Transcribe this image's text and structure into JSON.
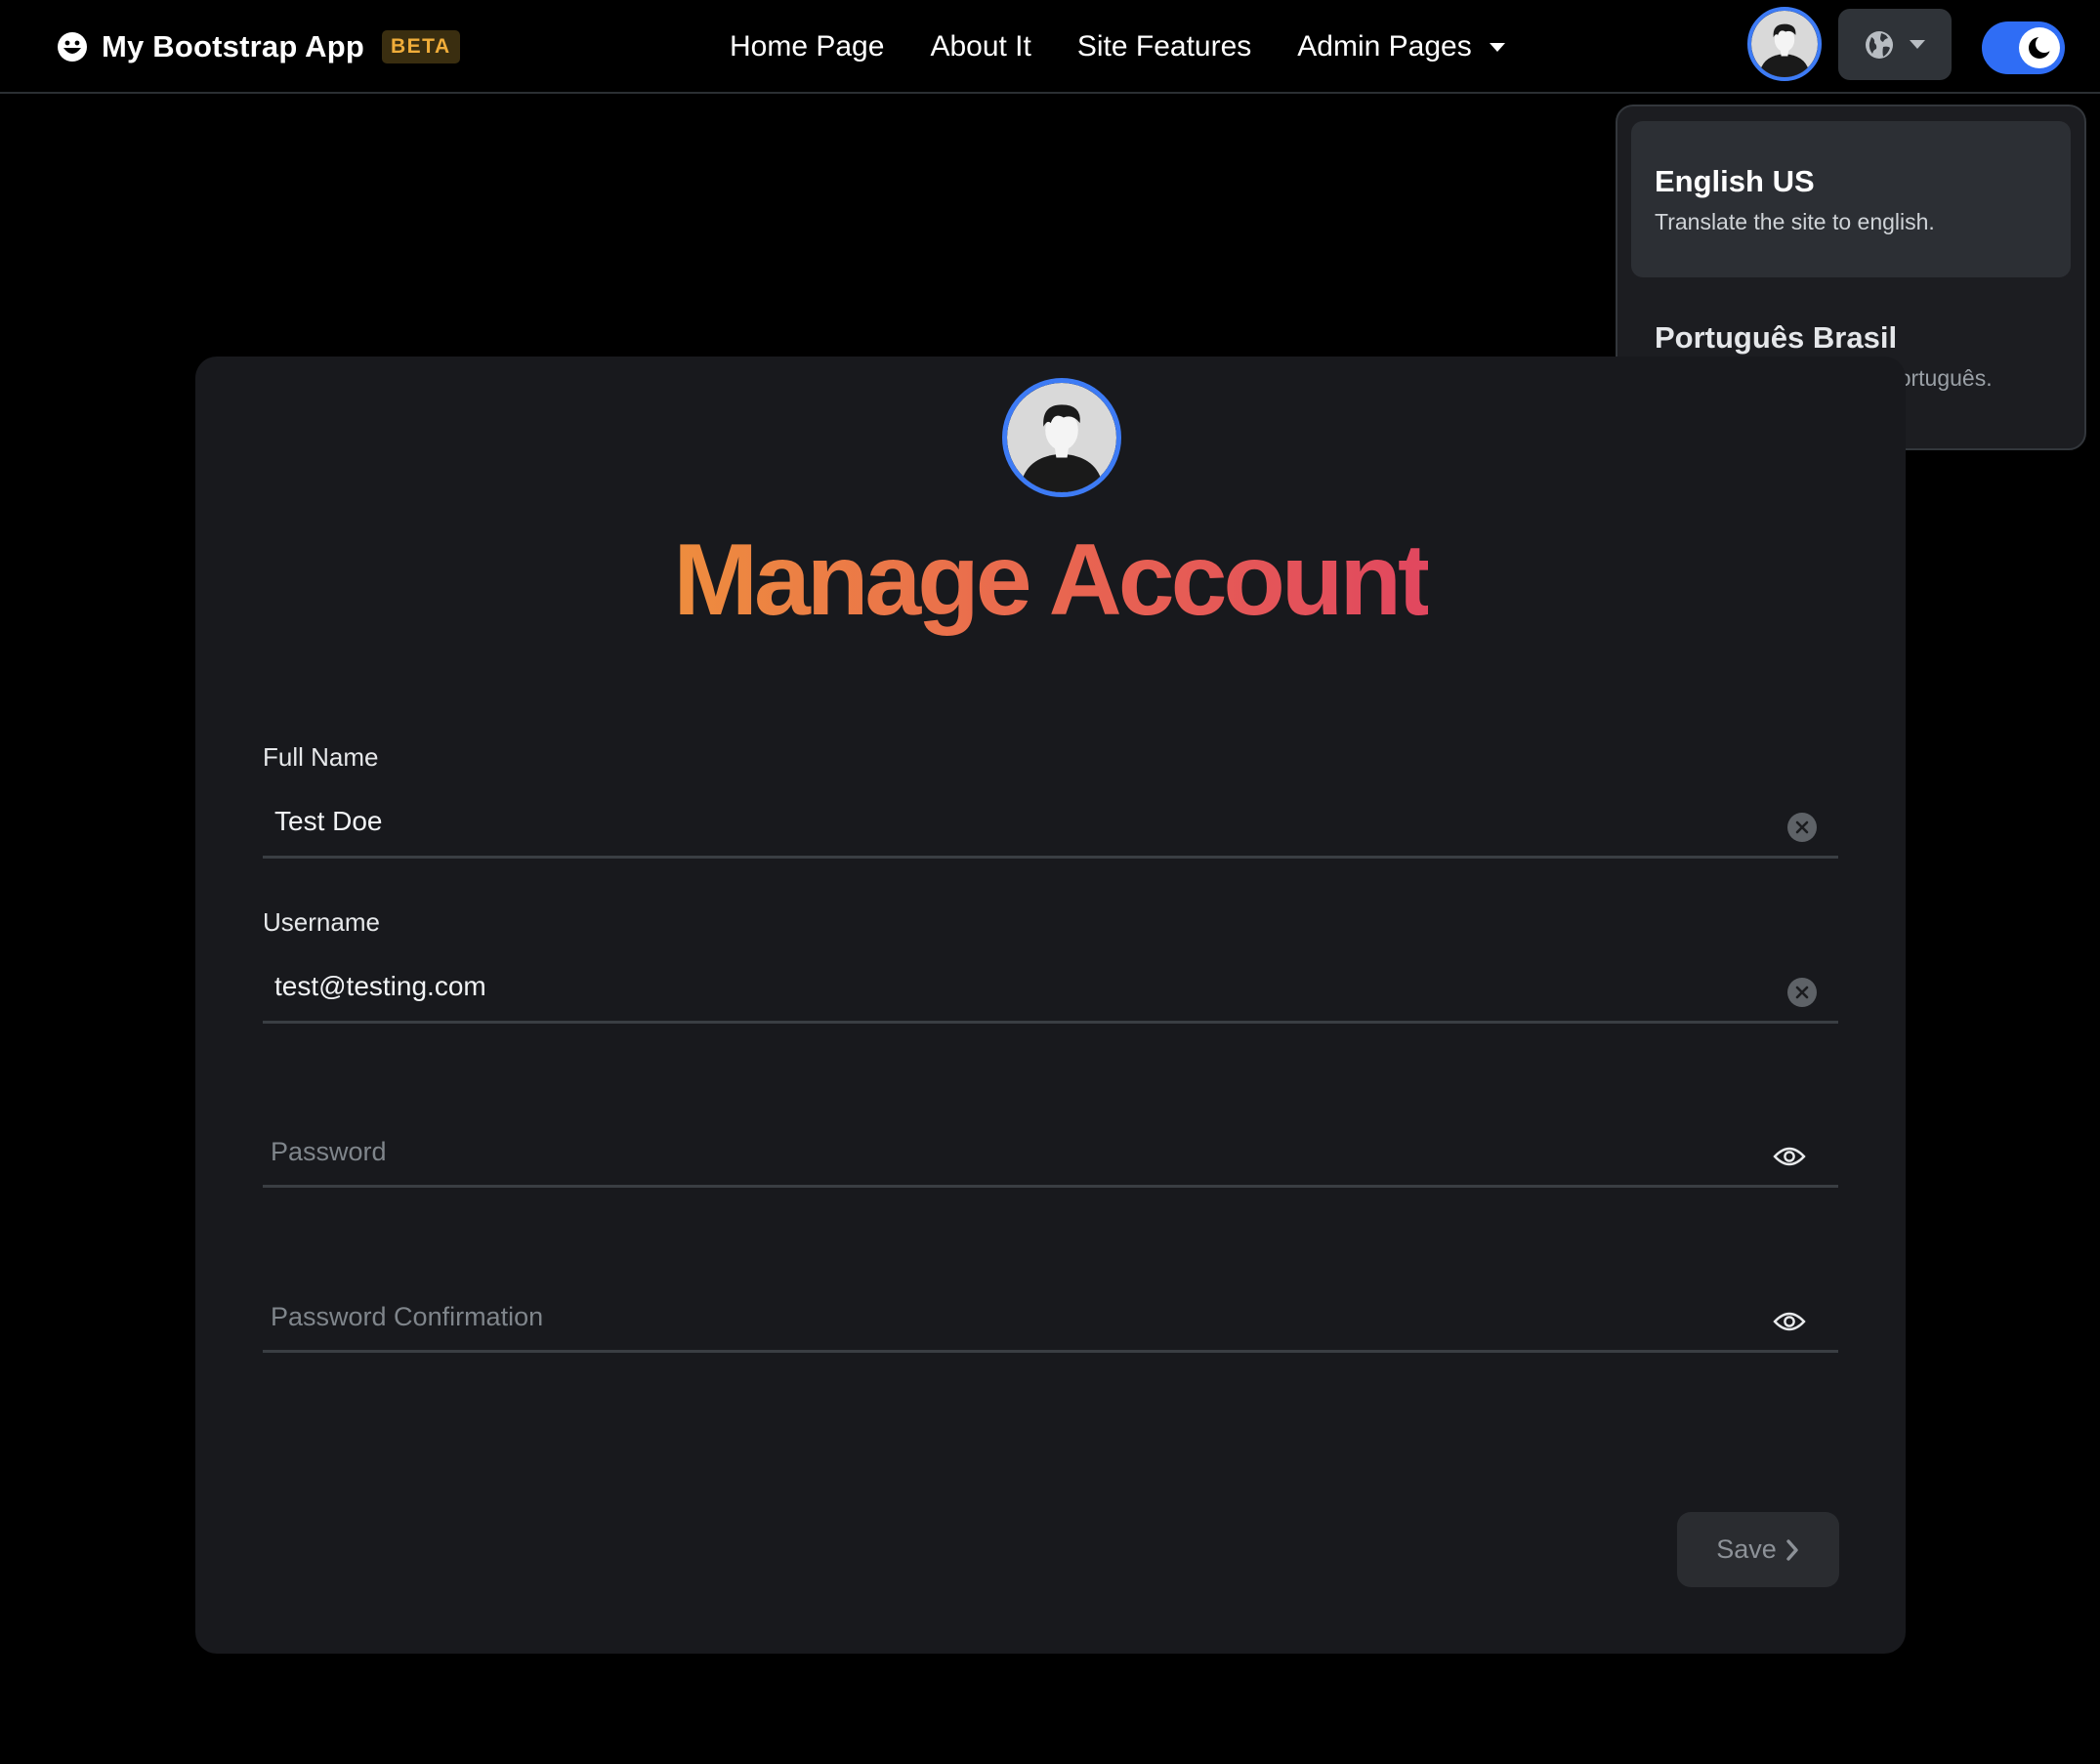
{
  "navbar": {
    "brand": "My Bootstrap App",
    "badge": "BETA",
    "links": [
      "Home Page",
      "About It",
      "Site Features"
    ],
    "dropdown_label": "Admin Pages",
    "icons": {
      "brand": "smile-icon",
      "language": "globe-icon",
      "theme": "moon-icon"
    }
  },
  "language_menu": {
    "items": [
      {
        "title": "English US",
        "description": "Translate the site to english."
      },
      {
        "title": "Português Brasil",
        "description": "Traduzir este site para Português."
      }
    ]
  },
  "form": {
    "title": "Manage Account",
    "fields": [
      {
        "label": "Full Name",
        "value": "Test Doe",
        "placeholder": ""
      },
      {
        "label": "Username",
        "value": "test@testing.com",
        "placeholder": ""
      },
      {
        "label": "",
        "value": "",
        "placeholder": "Password"
      },
      {
        "label": "",
        "value": "",
        "placeholder": "Password Confirmation"
      }
    ],
    "save_label": "Save"
  },
  "colors": {
    "accent_blue": "#3d7bf5",
    "title_gradient_start": "#ee8d3e",
    "title_gradient_end": "#e1475f",
    "badge_text": "#f0ad3a"
  }
}
